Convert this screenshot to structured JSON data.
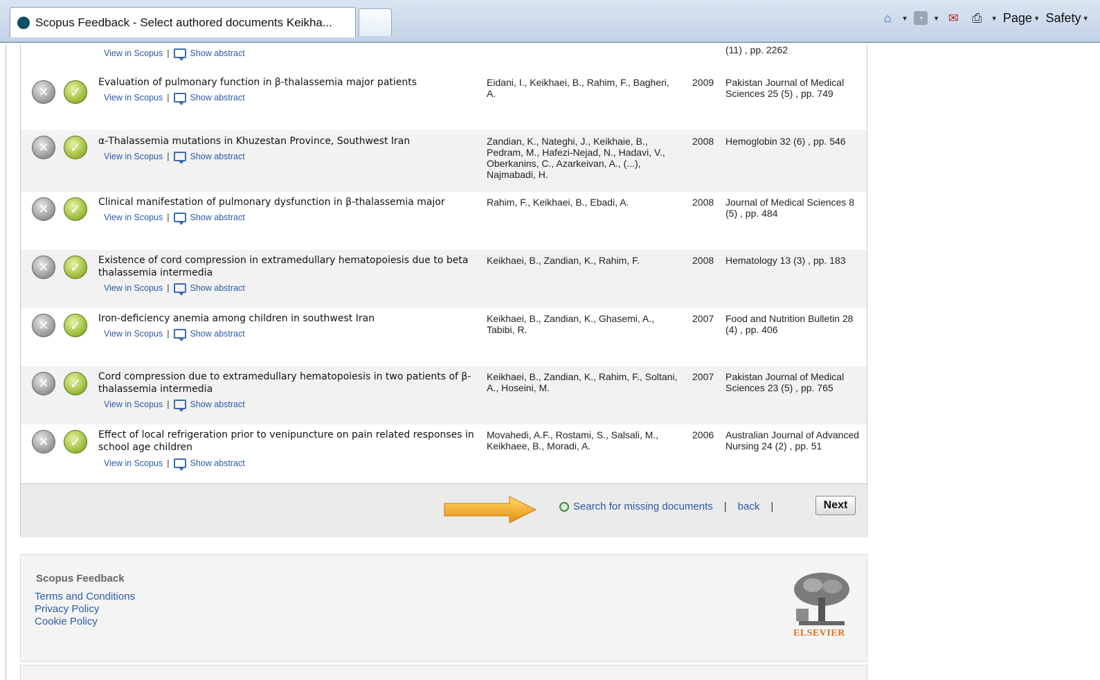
{
  "browser": {
    "tab_title": "Scopus Feedback - Select authored documents Keikha...",
    "menu_page": "Page",
    "menu_safety": "Safety",
    "caret": "▾"
  },
  "partial_row": {
    "source": "(11) , pp. 2262",
    "view": "View in Scopus",
    "abstract": "Show abstract"
  },
  "documents": [
    {
      "title": "Evaluation of pulmonary function in β-thalassemia major patients",
      "authors": "Eidani, I., Keikhaei, B., Rahim, F., Bagheri, A.",
      "year": "2009",
      "source": "Pakistan Journal of Medical Sciences 25 (5) , pp. 749",
      "view": "View in Scopus",
      "abstract": "Show abstract"
    },
    {
      "title": "α-Thalassemia mutations in Khuzestan Province, Southwest Iran",
      "authors": "Zandian, K., Nateghi, J., Keikhaie, B., Pedram, M., Hafezi-Nejad, N., Hadavi, V., Oberkanins, C., Azarkeivan, A., (...), Najmabadi, H.",
      "year": "2008",
      "source": "Hemoglobin 32 (6) , pp. 546",
      "view": "View in Scopus",
      "abstract": "Show abstract"
    },
    {
      "title": "Clinical manifestation of pulmonary dysfunction in β-thalassemia major",
      "authors": "Rahim, F., Keikhaei, B., Ebadi, A.",
      "year": "2008",
      "source": "Journal of Medical Sciences 8 (5) , pp. 484",
      "view": "View in Scopus",
      "abstract": "Show abstract"
    },
    {
      "title": "Existence of cord compression in extramedullary hematopoiesis due to beta thalassemia intermedia",
      "authors": "Keikhaei, B., Zandian, K., Rahim, F.",
      "year": "2008",
      "source": "Hematology 13 (3) , pp. 183",
      "view": "View in Scopus",
      "abstract": "Show abstract"
    },
    {
      "title": "Iron-deficiency anemia among children in southwest Iran",
      "authors": "Keikhaei, B., Zandian, K., Ghasemi, A., Tabibi, R.",
      "year": "2007",
      "source": "Food and Nutrition Bulletin 28 (4) , pp. 406",
      "view": "View in Scopus",
      "abstract": "Show abstract"
    },
    {
      "title": "Cord compression due to extramedullary hematopoiesis in two patients of β-thalassemia intermedia",
      "authors": "Keikhaei, B., Zandian, K., Rahim, F., Soltani, A., Hoseini, M.",
      "year": "2007",
      "source": "Pakistan Journal of Medical Sciences 23 (5) , pp. 765",
      "view": "View in Scopus",
      "abstract": "Show abstract"
    },
    {
      "title": "Effect of local refrigeration prior to venipuncture on pain related responses in school age children",
      "authors": "Movahedi, A.F., Rostami, S., Salsali, M., Keikhaee, B., Moradi, A.",
      "year": "2006",
      "source": "Australian Journal of Advanced Nursing 24 (2) , pp. 51",
      "view": "View in Scopus",
      "abstract": "Show abstract"
    }
  ],
  "actions": {
    "search_missing": "Search for missing documents",
    "back": "back",
    "next": "Next",
    "separator": "|"
  },
  "footer": {
    "title": "Scopus Feedback",
    "links": [
      "Terms and Conditions",
      "Privacy Policy",
      "Cookie Policy"
    ],
    "logo_text": "ELSEVIER"
  },
  "colors": {
    "link": "#2a5aa8",
    "alt_row": "#f2f2f2",
    "accept": "#9cbc3a",
    "arrow": "#f2a51c",
    "elsevier": "#e07020"
  },
  "icons": {
    "remove": "x-circle-icon",
    "accept": "check-circle-icon",
    "abstract": "abstract-icon",
    "search": "magnifier-icon"
  }
}
